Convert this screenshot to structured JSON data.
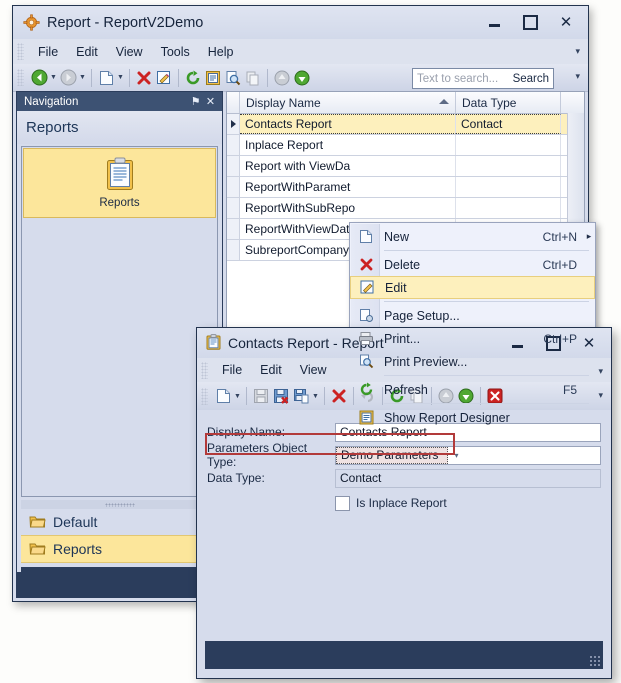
{
  "main_window": {
    "title": "Report - ReportV2Demo",
    "title_icon": "gear-icon",
    "buttons": {
      "minimize": "–",
      "maximize": "□",
      "close": "✕"
    },
    "menu": [
      "File",
      "Edit",
      "View",
      "Tools",
      "Help"
    ],
    "toolbar": [
      {
        "name": "back-icon",
        "glyph": "◀",
        "enabled": true,
        "dropdown": true
      },
      {
        "name": "forward-icon",
        "glyph": "▶",
        "enabled": false,
        "dropdown": true
      },
      {
        "name": "new-icon",
        "glyph": "□",
        "enabled": true,
        "dropdown": true
      },
      {
        "name": "delete-icon",
        "glyph": "✕",
        "enabled": true,
        "dropdown": false
      },
      {
        "name": "edit-icon",
        "glyph": "✎",
        "enabled": true,
        "dropdown": false
      },
      {
        "name": "refresh-icon",
        "glyph": "↻",
        "enabled": true,
        "dropdown": false
      },
      {
        "name": "report-designer-icon",
        "glyph": "▤",
        "enabled": true,
        "dropdown": false
      },
      {
        "name": "print-preview-icon",
        "glyph": "⚲",
        "enabled": true,
        "dropdown": false
      },
      {
        "name": "copy-icon",
        "glyph": "❐",
        "enabled": false,
        "dropdown": false
      },
      {
        "name": "move-up-icon",
        "glyph": "↑",
        "enabled": false,
        "dropdown": false
      },
      {
        "name": "move-down-icon",
        "glyph": "↓",
        "enabled": true,
        "dropdown": false
      }
    ],
    "search": {
      "placeholder": "Text to search...",
      "button_label": "Search",
      "value": ""
    },
    "expand_glyph": "▾"
  },
  "navigation": {
    "caption": "Navigation",
    "pin_glyph": "⚑",
    "close_glyph": "✕",
    "group_title": "Reports",
    "tile": {
      "label": "Reports",
      "icon": "clipboard-icon"
    },
    "items": [
      {
        "label": "Default",
        "icon": "folder-icon",
        "selected": false
      },
      {
        "label": "Reports",
        "icon": "folder-icon",
        "selected": true
      }
    ],
    "collapse_glyph": "▾"
  },
  "grid": {
    "columns": [
      {
        "label": "Display Name",
        "sort": "asc"
      },
      {
        "label": "Data Type",
        "sort": "none"
      }
    ],
    "rows": [
      {
        "display_name": "Contacts Report",
        "data_type": "Contact",
        "selected": true
      },
      {
        "display_name": "Inplace Report",
        "data_type": "",
        "selected": false
      },
      {
        "display_name": "Report with ViewDa",
        "data_type": "",
        "selected": false
      },
      {
        "display_name": "ReportWithParamet",
        "data_type": "",
        "selected": false
      },
      {
        "display_name": "ReportWithSubRepo",
        "data_type": "",
        "selected": false
      },
      {
        "display_name": "ReportWithViewDat",
        "data_type": "",
        "selected": false
      },
      {
        "display_name": "SubreportCompany",
        "data_type": "",
        "selected": false
      }
    ]
  },
  "context_menu": {
    "items": [
      {
        "label": "New",
        "shortcut": "Ctrl+N",
        "icon": "new-icon",
        "submenu": true,
        "highlighted": false,
        "separator_after": true
      },
      {
        "label": "Delete",
        "shortcut": "Ctrl+D",
        "icon": "delete-icon",
        "submenu": false,
        "highlighted": false,
        "separator_after": false
      },
      {
        "label": "Edit",
        "shortcut": "",
        "icon": "edit-icon",
        "submenu": false,
        "highlighted": true,
        "separator_after": true
      },
      {
        "label": "Page Setup...",
        "shortcut": "",
        "icon": "page-setup-icon",
        "submenu": false,
        "highlighted": false,
        "separator_after": false
      },
      {
        "label": "Print...",
        "shortcut": "Ctrl+P",
        "icon": "print-icon",
        "submenu": false,
        "highlighted": false,
        "separator_after": false
      },
      {
        "label": "Print Preview...",
        "shortcut": "",
        "icon": "print-preview-icon",
        "submenu": false,
        "highlighted": false,
        "separator_after": true
      },
      {
        "label": "Refresh",
        "shortcut": "F5",
        "icon": "refresh-icon",
        "submenu": false,
        "highlighted": false,
        "separator_after": true
      },
      {
        "label": "Show Report Designer",
        "shortcut": "",
        "icon": "report-designer-icon",
        "submenu": false,
        "highlighted": false,
        "separator_after": false
      }
    ],
    "submenu_glyph": "▸"
  },
  "dialog": {
    "title": "Contacts Report - Report",
    "title_icon": "clipboard-icon",
    "buttons": {
      "minimize": "–",
      "maximize": "□",
      "close": "✕"
    },
    "menu": [
      "File",
      "Edit",
      "View"
    ],
    "toolbar": [
      {
        "name": "new-icon",
        "glyph": "□",
        "enabled": true,
        "dropdown": true
      },
      {
        "name": "save-icon",
        "glyph": "▣",
        "enabled": false,
        "dropdown": false
      },
      {
        "name": "save-and-close-icon",
        "glyph": "▣",
        "enabled": true,
        "dropdown": false
      },
      {
        "name": "save-and-new-icon",
        "glyph": "▣",
        "enabled": true,
        "dropdown": true
      },
      {
        "name": "delete-icon",
        "glyph": "✕",
        "enabled": true,
        "dropdown": false
      },
      {
        "name": "undo-icon",
        "glyph": "↶",
        "enabled": false,
        "dropdown": false
      },
      {
        "name": "refresh-icon",
        "glyph": "↻",
        "enabled": true,
        "dropdown": false
      },
      {
        "name": "copy-icon",
        "glyph": "❐",
        "enabled": false,
        "dropdown": false
      },
      {
        "name": "previous-object-icon",
        "glyph": "↑",
        "enabled": false,
        "dropdown": false
      },
      {
        "name": "next-object-icon",
        "glyph": "↓",
        "enabled": true,
        "dropdown": false
      },
      {
        "name": "close-icon",
        "glyph": "✕",
        "enabled": true,
        "dropdown": false
      }
    ],
    "expand_glyph": "▾",
    "fields": {
      "display_name": {
        "label": "Display Name:",
        "value": "Contacts Report"
      },
      "parameters_object_type": {
        "label": "Parameters Object Type:",
        "value": "Demo Parameters",
        "dropdown_glyph": "▾",
        "highlight_color": "#b23a3a"
      },
      "data_type": {
        "label": "Data Type:",
        "value": "Contact"
      },
      "is_inplace_report": {
        "label": "Is Inplace Report",
        "checked": false
      }
    }
  }
}
